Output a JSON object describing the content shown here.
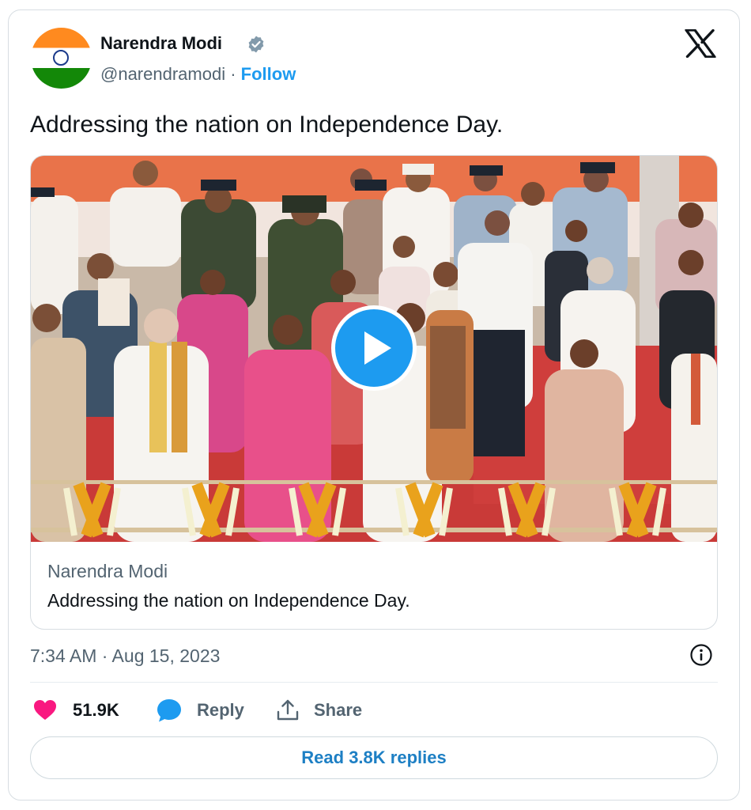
{
  "author": {
    "name": "Narendra Modi",
    "handle": "@narendramodi",
    "separator": "·",
    "follow_label": "Follow",
    "verified": true
  },
  "brand": {
    "logo_icon": "x-logo-icon"
  },
  "tweet": {
    "text": "Addressing the nation on Independence Day."
  },
  "media_card": {
    "type": "video",
    "title": "Narendra Modi",
    "description": "Addressing the nation on Independence Day.",
    "play_icon": "play-icon"
  },
  "meta": {
    "timestamp": "7:34 AM · Aug 15, 2023",
    "info_icon": "info-icon"
  },
  "actions": {
    "like_count": "51.9K",
    "reply_label": "Reply",
    "share_label": "Share"
  },
  "read_replies_label": "Read 3.8K replies",
  "colors": {
    "accent": "#1d9bf0",
    "like": "#f91880",
    "muted_text": "#536471",
    "text": "#0f1419",
    "border": "#d7dde2"
  }
}
